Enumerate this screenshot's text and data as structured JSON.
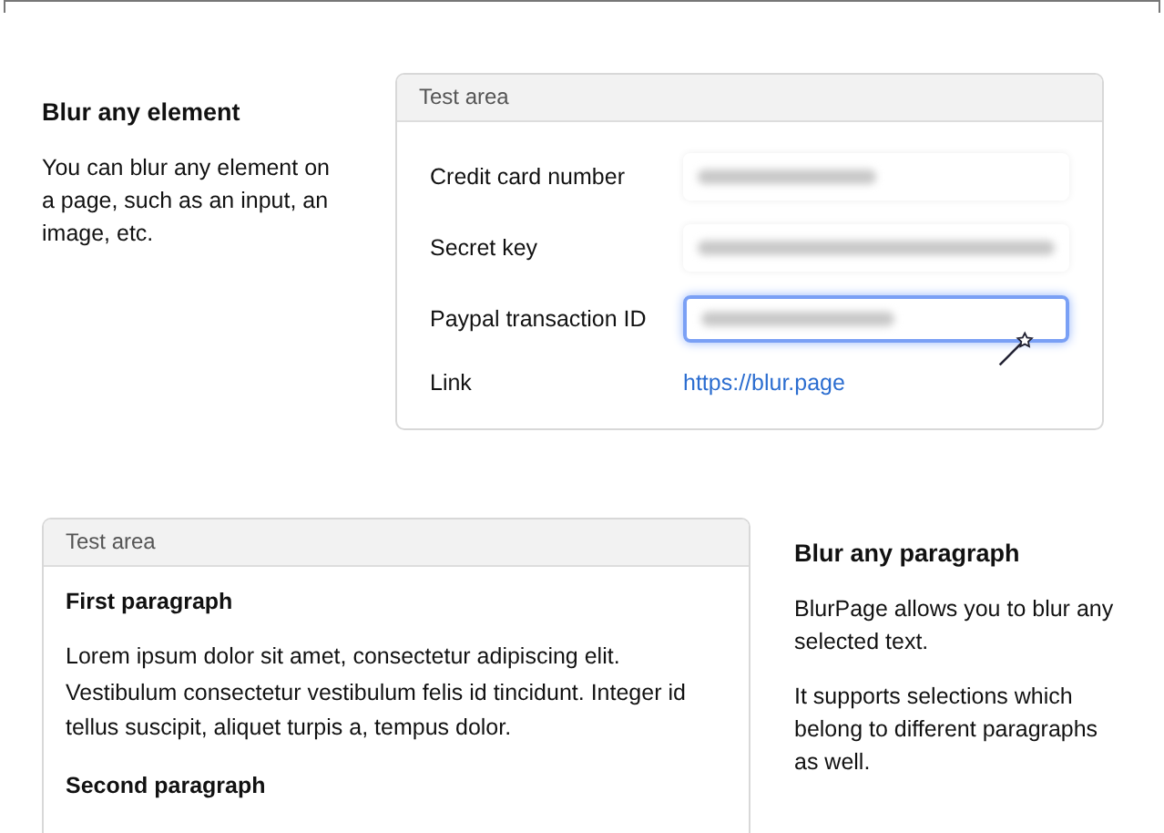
{
  "sections": [
    {
      "title": "Blur any element",
      "paragraphs": [
        "You can blur any element on a page, such as an input, an image, etc."
      ],
      "card": {
        "header": "Test area",
        "fields": [
          {
            "kind": "input",
            "label": "Credit card number",
            "highlighted": false
          },
          {
            "kind": "input",
            "label": "Secret key",
            "highlighted": false
          },
          {
            "kind": "input",
            "label": "Paypal transaction ID",
            "highlighted": true
          },
          {
            "kind": "link",
            "label": "Link",
            "value": "https://blur.page"
          }
        ]
      }
    },
    {
      "title": "Blur any paragraph",
      "paragraphs": [
        "BlurPage allows you to blur any selected text.",
        "It supports selections which belong to different paragraphs as well."
      ],
      "card": {
        "header": "Test area",
        "blocks": [
          {
            "kind": "heading",
            "text": "First paragraph"
          },
          {
            "kind": "paragraph",
            "text": "Lorem ipsum dolor sit amet, consectetur adipiscing elit. Vestibulum consectetur vestibulum felis id tincidunt. Integer id tellus suscipit, aliquet turpis a, tempus dolor."
          },
          {
            "kind": "heading",
            "text": "Second paragraph"
          }
        ]
      }
    }
  ]
}
